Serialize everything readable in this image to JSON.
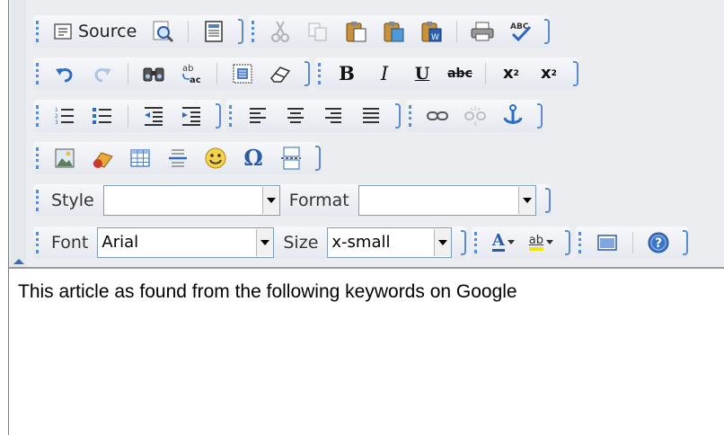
{
  "toolbar": {
    "source_label": "Source",
    "style_label": "Style",
    "style_value": "",
    "format_label": "Format",
    "format_value": "",
    "font_label": "Font",
    "font_value": "Arial",
    "size_label": "Size",
    "size_value": "x-small",
    "bold_label": "B",
    "italic_label": "I",
    "underline_label": "U",
    "strike_label": "abc",
    "subscript_label": "x",
    "subscript_mark": "2",
    "superscript_label": "x",
    "superscript_mark": "2",
    "find_replace_label_top": "ab",
    "find_replace_label_bottom": "ac",
    "text_color_label": "A",
    "bg_color_label": "ab",
    "omega_label": "Ω",
    "spellcheck_label": "ABC",
    "icons": [
      "document-icon",
      "preview-icon",
      "templates-icon",
      "cut-icon",
      "copy-icon",
      "paste-icon",
      "paste-text-icon",
      "paste-word-icon",
      "print-icon",
      "spellcheck-icon",
      "undo-icon",
      "redo-icon",
      "find-icon",
      "replace-icon",
      "select-all-icon",
      "eraser-icon",
      "numbered-list-icon",
      "bulleted-list-icon",
      "outdent-icon",
      "indent-icon",
      "align-left-icon",
      "align-center-icon",
      "align-right-icon",
      "justify-icon",
      "link-icon",
      "unlink-icon",
      "anchor-icon",
      "image-icon",
      "flash-icon",
      "table-icon",
      "horizontal-rule-icon",
      "smiley-icon",
      "special-char-icon",
      "page-break-icon",
      "maximize-icon",
      "about-icon"
    ]
  },
  "colors": {
    "accent": "#5b8bd0",
    "toolbar_bg": "#ecedf1"
  },
  "content": {
    "text": "This article as found from the following keywords on Google"
  }
}
